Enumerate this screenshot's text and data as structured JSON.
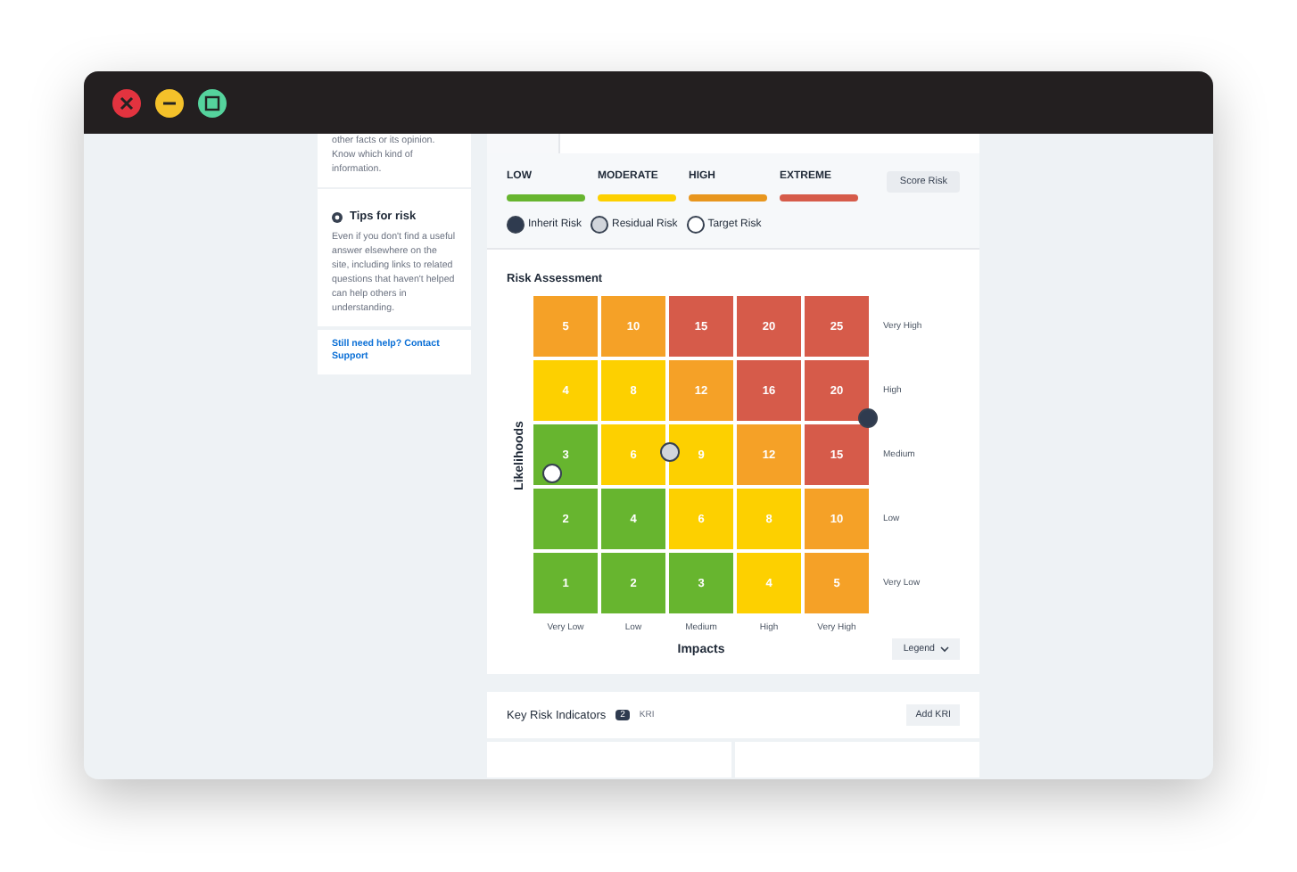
{
  "sidebar": {
    "intro": "other facts or its opinion. Know which kind of information.",
    "tips_title": "Tips for risk",
    "tips_text": "Even if you don't find a useful answer elsewhere on the site, including links to related questions that haven't helped can help others in understanding.",
    "help_link": "Still need help? Contact Support"
  },
  "levels": [
    {
      "label": "LOW",
      "color": "#67b52f"
    },
    {
      "label": "MODERATE",
      "color": "#fdd000"
    },
    {
      "label": "HIGH",
      "color": "#e8961e"
    },
    {
      "label": "EXTREME",
      "color": "#d65b4a"
    }
  ],
  "score_button": "Score Risk",
  "marker_legend": [
    {
      "kind": "inherit",
      "label": "Inherit Risk"
    },
    {
      "kind": "residual",
      "label": "Residual Risk"
    },
    {
      "kind": "target",
      "label": "Target Risk"
    }
  ],
  "assessment": {
    "title": "Risk Assessment",
    "y_axis": "Likelihoods",
    "x_axis": "Impacts",
    "row_labels": [
      "Very High",
      "High",
      "Medium",
      "Low",
      "Very Low"
    ],
    "column_labels": [
      "Very Low",
      "Low",
      "Medium",
      "High",
      "Very High"
    ],
    "rows": [
      [
        {
          "value": "5",
          "color": "#f5a127"
        },
        {
          "value": "10",
          "color": "#f5a127"
        },
        {
          "value": "15",
          "color": "#d65b4a"
        },
        {
          "value": "20",
          "color": "#d65b4a"
        },
        {
          "value": "25",
          "color": "#d65b4a"
        }
      ],
      [
        {
          "value": "4",
          "color": "#fdd000"
        },
        {
          "value": "8",
          "color": "#fdd000"
        },
        {
          "value": "12",
          "color": "#f5a127"
        },
        {
          "value": "16",
          "color": "#d65b4a"
        },
        {
          "value": "20",
          "color": "#d65b4a",
          "inherit_risk": true
        }
      ],
      [
        {
          "value": "3",
          "color": "#67b52f",
          "target_risk": true
        },
        {
          "value": "6",
          "color": "#fdd000"
        },
        {
          "value": "9",
          "color": "#fdd000",
          "residual_risk": true
        },
        {
          "value": "12",
          "color": "#f5a127"
        },
        {
          "value": "15",
          "color": "#d65b4a"
        }
      ],
      [
        {
          "value": "2",
          "color": "#67b52f"
        },
        {
          "value": "4",
          "color": "#67b52f"
        },
        {
          "value": "6",
          "color": "#fdd000"
        },
        {
          "value": "8",
          "color": "#fdd000"
        },
        {
          "value": "10",
          "color": "#f5a127"
        }
      ],
      [
        {
          "value": "1",
          "color": "#67b52f"
        },
        {
          "value": "2",
          "color": "#67b52f"
        },
        {
          "value": "3",
          "color": "#67b52f"
        },
        {
          "value": "4",
          "color": "#fdd000"
        },
        {
          "value": "5",
          "color": "#f5a127"
        }
      ]
    ],
    "legend_button": "Legend"
  },
  "kri": {
    "title": "Key Risk Indicators",
    "count": "2",
    "unit": "KRI",
    "add_button": "Add KRI"
  }
}
